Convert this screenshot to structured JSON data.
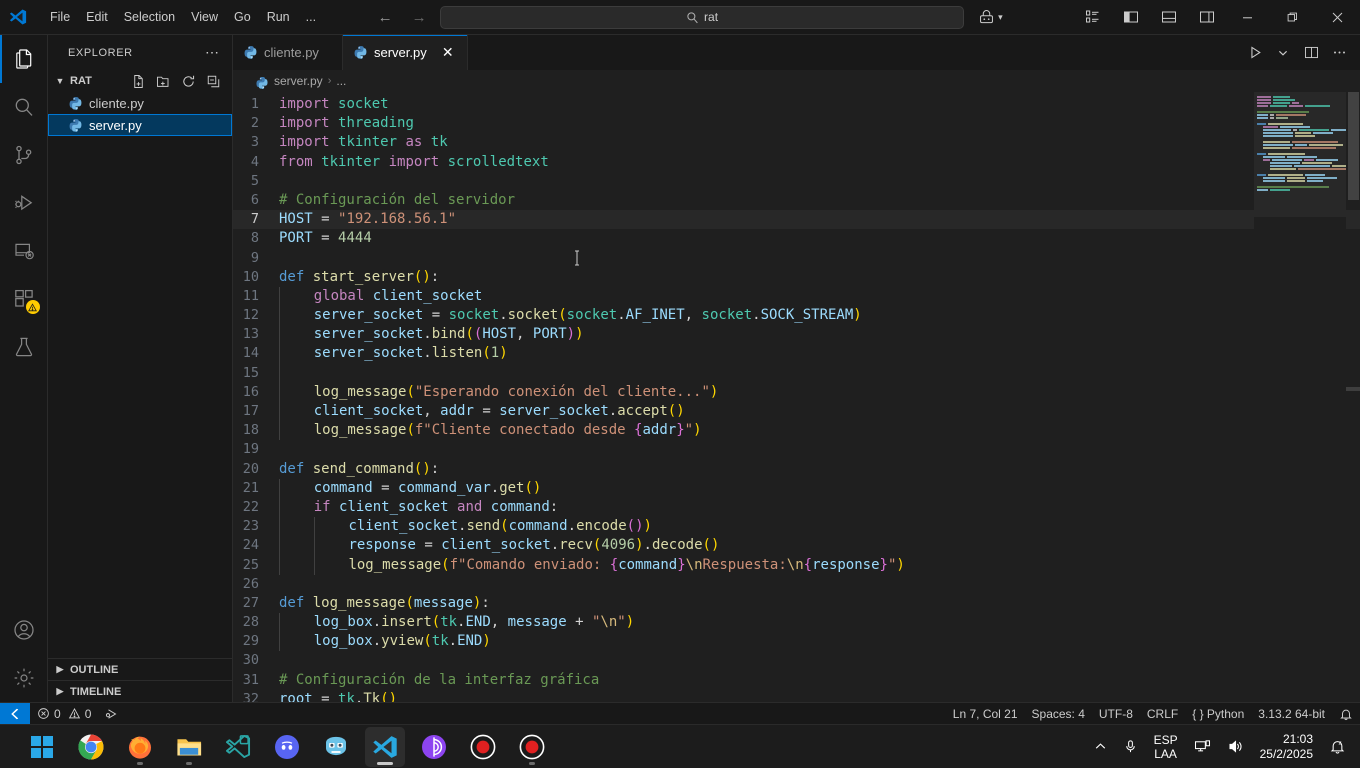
{
  "titlebar": {
    "logo": "vscode-logo",
    "menus": [
      "File",
      "Edit",
      "Selection",
      "View",
      "Go",
      "Run",
      "..."
    ],
    "back_arrow": "←",
    "forward_arrow": "→",
    "command_center": {
      "value": "rat",
      "icon": "search-icon"
    },
    "accounts_icon": "remote-accounts-icon",
    "layout_icons": [
      "customize-layout-icon",
      "toggle-primary-sidebar-icon",
      "toggle-panel-icon",
      "toggle-secondary-sidebar-icon"
    ],
    "window_controls": {
      "minimize": "—",
      "maximize": "❐",
      "close": "✕"
    }
  },
  "activitybar": {
    "items": [
      {
        "name": "explorer",
        "icon": "files-icon",
        "active": true
      },
      {
        "name": "search",
        "icon": "search-icon",
        "active": false
      },
      {
        "name": "source-control",
        "icon": "source-control-icon",
        "active": false
      },
      {
        "name": "run-and-debug",
        "icon": "debug-icon",
        "active": false
      },
      {
        "name": "remote-explorer",
        "icon": "remote-explorer-icon",
        "active": false
      },
      {
        "name": "extensions",
        "icon": "extensions-icon",
        "active": false,
        "badge": "!"
      },
      {
        "name": "testing",
        "icon": "beaker-icon",
        "active": false
      }
    ],
    "bottom": [
      {
        "name": "accounts",
        "icon": "account-icon"
      },
      {
        "name": "settings",
        "icon": "gear-icon"
      }
    ]
  },
  "sidebar": {
    "title": "EXPLORER",
    "more_actions": "⋯",
    "folder": {
      "name": "RAT",
      "expanded": true,
      "actions": [
        "new-file-icon",
        "new-folder-icon",
        "refresh-icon",
        "collapse-all-icon"
      ]
    },
    "files": [
      {
        "label": "cliente.py",
        "icon": "python-file-icon",
        "selected": false
      },
      {
        "label": "server.py",
        "icon": "python-file-icon",
        "selected": true
      }
    ],
    "panels": [
      {
        "label": "OUTLINE",
        "expanded": false
      },
      {
        "label": "TIMELINE",
        "expanded": false
      }
    ]
  },
  "editor": {
    "tabs": [
      {
        "label": "cliente.py",
        "icon": "python-file-icon",
        "active": false,
        "closable": false
      },
      {
        "label": "server.py",
        "icon": "python-file-icon",
        "active": true,
        "closable": true,
        "close_glyph": "✕"
      }
    ],
    "tabbar_actions": [
      "run-python-file-icon",
      "chevron-down-icon",
      "split-editor-icon",
      "more-actions-icon"
    ],
    "breadcrumb": {
      "file": "server.py",
      "separator": "›",
      "trail": "..."
    },
    "current_line": 7,
    "total_visible_lines": 32,
    "lines": [
      {
        "n": 1,
        "text": "import socket"
      },
      {
        "n": 2,
        "text": "import threading"
      },
      {
        "n": 3,
        "text": "import tkinter as tk"
      },
      {
        "n": 4,
        "text": "from tkinter import scrolledtext"
      },
      {
        "n": 5,
        "text": ""
      },
      {
        "n": 6,
        "text": "# Configuración del servidor"
      },
      {
        "n": 7,
        "text": "HOST = \"192.168.56.1\""
      },
      {
        "n": 8,
        "text": "PORT = 4444"
      },
      {
        "n": 9,
        "text": ""
      },
      {
        "n": 10,
        "text": "def start_server():"
      },
      {
        "n": 11,
        "text": "    global client_socket"
      },
      {
        "n": 12,
        "text": "    server_socket = socket.socket(socket.AF_INET, socket.SOCK_STREAM)"
      },
      {
        "n": 13,
        "text": "    server_socket.bind((HOST, PORT))"
      },
      {
        "n": 14,
        "text": "    server_socket.listen(1)"
      },
      {
        "n": 15,
        "text": ""
      },
      {
        "n": 16,
        "text": "    log_message(\"Esperando conexión del cliente...\")"
      },
      {
        "n": 17,
        "text": "    client_socket, addr = server_socket.accept()"
      },
      {
        "n": 18,
        "text": "    log_message(f\"Cliente conectado desde {addr}\")"
      },
      {
        "n": 19,
        "text": ""
      },
      {
        "n": 20,
        "text": "def send_command():"
      },
      {
        "n": 21,
        "text": "    command = command_var.get()"
      },
      {
        "n": 22,
        "text": "    if client_socket and command:"
      },
      {
        "n": 23,
        "text": "        client_socket.send(command.encode())"
      },
      {
        "n": 24,
        "text": "        response = client_socket.recv(4096).decode()"
      },
      {
        "n": 25,
        "text": "        log_message(f\"Comando enviado: {command}\\nRespuesta:\\n{response}\")"
      },
      {
        "n": 26,
        "text": ""
      },
      {
        "n": 27,
        "text": "def log_message(message):"
      },
      {
        "n": 28,
        "text": "    log_box.insert(tk.END, message + \"\\n\")"
      },
      {
        "n": 29,
        "text": "    log_box.yview(tk.END)"
      },
      {
        "n": 30,
        "text": ""
      },
      {
        "n": 31,
        "text": "# Configuración de la interfaz gráfica"
      },
      {
        "n": 32,
        "text": "root = tk.Tk()"
      }
    ]
  },
  "statusbar": {
    "remote_icon": "remote-window-icon",
    "problems": {
      "errors_icon": "error-icon",
      "errors": "0",
      "warnings_icon": "warning-icon",
      "warnings": "0"
    },
    "ports_icon": "ports-forwarded-icon",
    "right": [
      {
        "name": "cursor-position",
        "label": "Ln 7, Col 21"
      },
      {
        "name": "indentation",
        "label": "Spaces: 4"
      },
      {
        "name": "encoding",
        "label": "UTF-8"
      },
      {
        "name": "line-endings",
        "label": "CRLF"
      },
      {
        "name": "language-mode",
        "label": "{ } Python"
      },
      {
        "name": "python-interpreter",
        "label": "3.13.2 64-bit"
      },
      {
        "name": "notifications",
        "label": "🔔"
      }
    ]
  },
  "taskbar": {
    "apps": [
      {
        "name": "start-button",
        "icon": "windows-start-icon",
        "active": false,
        "running": false
      },
      {
        "name": "google-chrome",
        "icon": "chrome-icon",
        "active": false,
        "running": false
      },
      {
        "name": "firefox",
        "icon": "firefox-icon",
        "active": false,
        "running": true
      },
      {
        "name": "file-explorer",
        "icon": "folder-icon",
        "active": false,
        "running": true
      },
      {
        "name": "vscode-insiders",
        "icon": "vscode-alt-icon",
        "active": false,
        "running": false
      },
      {
        "name": "discord",
        "icon": "discord-icon",
        "active": false,
        "running": false
      },
      {
        "name": "godot-engine",
        "icon": "godot-icon",
        "active": false,
        "running": false
      },
      {
        "name": "visual-studio-code",
        "icon": "vscode-icon",
        "active": true,
        "running": true
      },
      {
        "name": "tor-browser",
        "icon": "tor-icon",
        "active": false,
        "running": false
      },
      {
        "name": "screen-recorder",
        "icon": "record-icon",
        "active": false,
        "running": false
      },
      {
        "name": "obs-recorder",
        "icon": "record-icon",
        "active": false,
        "running": true
      }
    ],
    "tray": {
      "show_hidden_icons": "chevron-up-icon",
      "microphone_icon": "microphone-icon",
      "keyboard_layout_line1": "ESP",
      "keyboard_layout_line2": "LAA",
      "network_icon": "network-icon",
      "volume_icon": "volume-icon",
      "time": "21:03",
      "date": "25/2/2025",
      "notifications_icon": "notifications-bell-icon"
    }
  },
  "colors": {
    "accent": "#0078d4",
    "editor_bg": "#1f1f1f",
    "chrome_bg": "#181818",
    "selection": "#04395e",
    "badge_warning": "#ffcc00"
  }
}
